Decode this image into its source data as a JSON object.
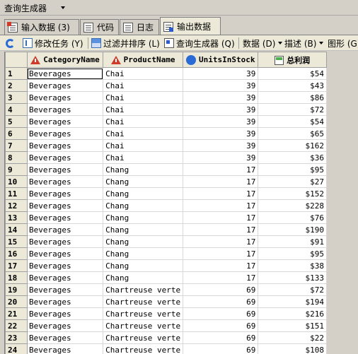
{
  "window": {
    "title": "查询生成器"
  },
  "tabs": [
    {
      "label": "输入数据 (3)"
    },
    {
      "label": "代码"
    },
    {
      "label": "日志"
    },
    {
      "label": "输出数据"
    }
  ],
  "toolbar": {
    "modify": "修改任务 (Y)",
    "filter": "过滤并排序 (L)",
    "builder": "查询生成器 (Q)",
    "data": "数据 (D)",
    "describe": "描述 (B)",
    "graph": "图形 (G)"
  },
  "table": {
    "columns": [
      "CategoryName",
      "ProductName",
      "UnitsInStock",
      "总利润"
    ],
    "rows": [
      [
        "1",
        "Beverages",
        "Chai",
        "39",
        "$54"
      ],
      [
        "2",
        "Beverages",
        "Chai",
        "39",
        "$43"
      ],
      [
        "3",
        "Beverages",
        "Chai",
        "39",
        "$86"
      ],
      [
        "4",
        "Beverages",
        "Chai",
        "39",
        "$72"
      ],
      [
        "5",
        "Beverages",
        "Chai",
        "39",
        "$54"
      ],
      [
        "6",
        "Beverages",
        "Chai",
        "39",
        "$65"
      ],
      [
        "7",
        "Beverages",
        "Chai",
        "39",
        "$162"
      ],
      [
        "8",
        "Beverages",
        "Chai",
        "39",
        "$36"
      ],
      [
        "9",
        "Beverages",
        "Chang",
        "17",
        "$95"
      ],
      [
        "10",
        "Beverages",
        "Chang",
        "17",
        "$27"
      ],
      [
        "11",
        "Beverages",
        "Chang",
        "17",
        "$152"
      ],
      [
        "12",
        "Beverages",
        "Chang",
        "17",
        "$228"
      ],
      [
        "13",
        "Beverages",
        "Chang",
        "17",
        "$76"
      ],
      [
        "14",
        "Beverages",
        "Chang",
        "17",
        "$190"
      ],
      [
        "15",
        "Beverages",
        "Chang",
        "17",
        "$91"
      ],
      [
        "16",
        "Beverages",
        "Chang",
        "17",
        "$95"
      ],
      [
        "17",
        "Beverages",
        "Chang",
        "17",
        "$38"
      ],
      [
        "18",
        "Beverages",
        "Chang",
        "17",
        "$133"
      ],
      [
        "19",
        "Beverages",
        "Chartreuse verte",
        "69",
        "$72"
      ],
      [
        "20",
        "Beverages",
        "Chartreuse verte",
        "69",
        "$194"
      ],
      [
        "21",
        "Beverages",
        "Chartreuse verte",
        "69",
        "$216"
      ],
      [
        "22",
        "Beverages",
        "Chartreuse verte",
        "69",
        "$151"
      ],
      [
        "23",
        "Beverages",
        "Chartreuse verte",
        "69",
        "$22"
      ],
      [
        "24",
        "Beverages",
        "Chartreuse verte",
        "69",
        "$108"
      ]
    ]
  }
}
